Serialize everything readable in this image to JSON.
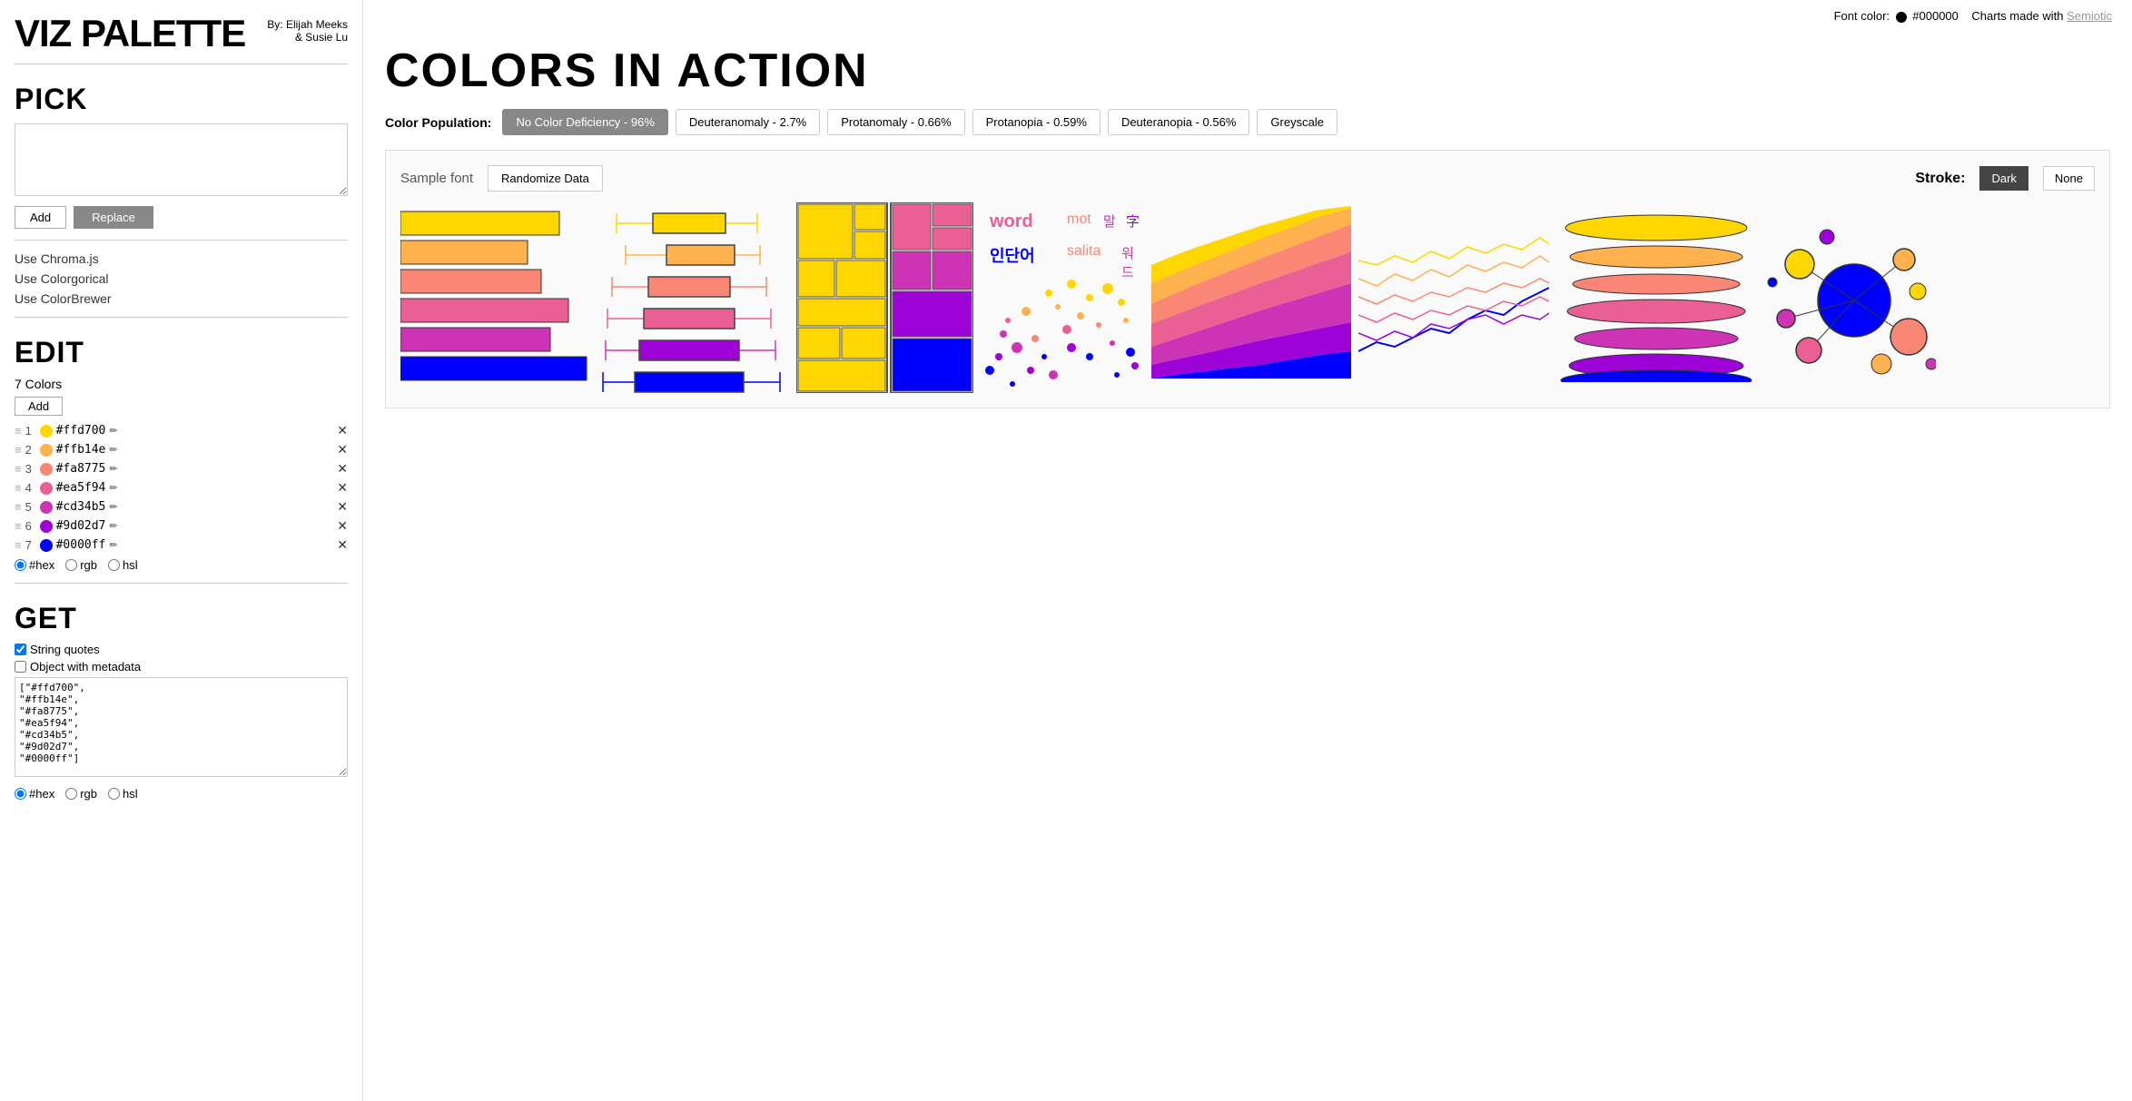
{
  "app": {
    "title": "VIZ PALETTE",
    "subtitle_line1": "By: Elijah Meeks",
    "subtitle_line2": "& Susie Lu"
  },
  "font_color": {
    "label": "Font color:",
    "value": "#000000"
  },
  "charts_made_with": "Charts made with",
  "semiotic_label": "Semiotic",
  "page_title": "COLORS IN ACTION",
  "color_population": {
    "label": "Color Population:",
    "tabs": [
      {
        "id": "none",
        "label": "No Color Deficiency - 96%",
        "active": true
      },
      {
        "id": "deuter_anomaly",
        "label": "Deuteranomaly - 2.7%",
        "active": false
      },
      {
        "id": "prot_anomaly",
        "label": "Protanomaly - 0.66%",
        "active": false
      },
      {
        "id": "prot_opia",
        "label": "Protanopia - 0.59%",
        "active": false
      },
      {
        "id": "deuter_opia",
        "label": "Deuteranopia - 0.56%",
        "active": false
      },
      {
        "id": "greyscale",
        "label": "Greyscale",
        "active": false
      }
    ]
  },
  "pick": {
    "section_label": "PICK",
    "textarea_placeholder": "",
    "add_label": "Add",
    "replace_label": "Replace",
    "use_chromajs": "Use Chroma.js",
    "use_colorgorical": "Use Colorgorical",
    "use_colorbrewer": "Use ColorBrewer"
  },
  "edit": {
    "section_label": "EDIT",
    "colors_count": "7 Colors",
    "add_label": "Add",
    "format_options": [
      "#hex",
      "rgb",
      "hsl"
    ],
    "colors": [
      {
        "num": 1,
        "hex": "#ffd700",
        "color": "#ffd700"
      },
      {
        "num": 2,
        "hex": "#ffb14e",
        "color": "#ffb14e"
      },
      {
        "num": 3,
        "hex": "#fa8775",
        "color": "#fa8775"
      },
      {
        "num": 4,
        "hex": "#ea5f94",
        "color": "#ea5f94"
      },
      {
        "num": 5,
        "hex": "#cd34b5",
        "color": "#cd34b5"
      },
      {
        "num": 6,
        "hex": "#9d02d7",
        "color": "#9d02d7"
      },
      {
        "num": 7,
        "hex": "#0000ff",
        "color": "#0000ff"
      }
    ]
  },
  "get": {
    "section_label": "GET",
    "string_quotes_label": "String quotes",
    "object_metadata_label": "Object with metadata",
    "output": "[\"#ffd700\",\n\"#ffb14e\",\n\"#fa8775\",\n\"#ea5f94\",\n\"#cd34b5\",\n\"#9d02d7\",\n\"#0000ff\"]",
    "format_options": [
      "#hex",
      "rgb",
      "hsl"
    ]
  },
  "charts": {
    "sample_font": "Sample font",
    "randomize_label": "Randomize Data",
    "stroke_label": "Stroke:",
    "stroke_options": [
      {
        "label": "Dark",
        "active": true
      },
      {
        "label": "None",
        "active": false
      }
    ]
  },
  "colors_palette": [
    "#ffd700",
    "#ffb14e",
    "#fa8775",
    "#ea5f94",
    "#cd34b5",
    "#9d02d7",
    "#0000ff"
  ]
}
